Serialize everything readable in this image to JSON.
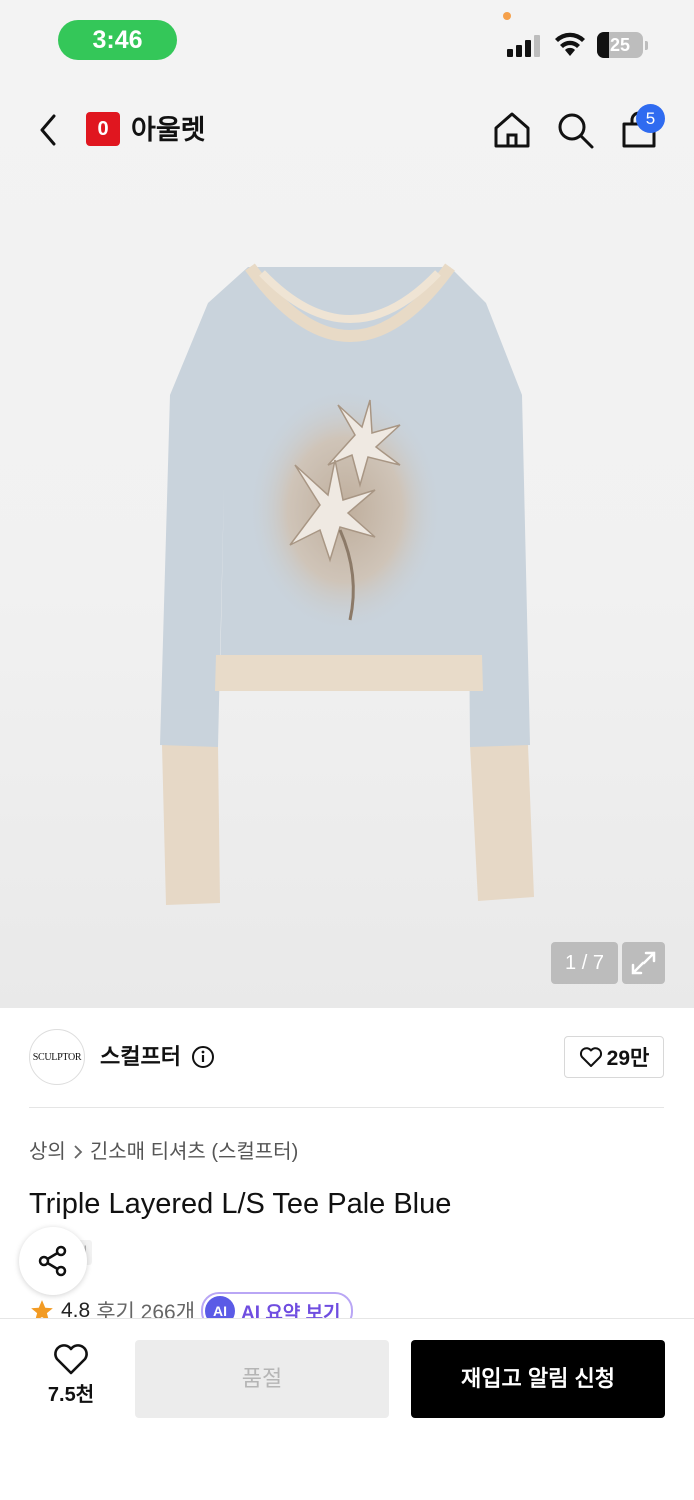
{
  "status_bar": {
    "time": "3:46",
    "battery": "25"
  },
  "header": {
    "brand_logo_letter": "0",
    "brand_name": "아울렛",
    "cart_count": "5"
  },
  "gallery": {
    "pager": "1 / 7"
  },
  "store": {
    "logo_text": "SCULPTOR",
    "name": "스컬프터",
    "likes": "29만"
  },
  "breadcrumb": [
    "상의",
    "긴소매 티셔츠 (스컬프터)"
  ],
  "product": {
    "title": "Triple Layered L/S Tee Pale Blue",
    "hidden_tag": "전",
    "rating": "4.8",
    "reviews": "후기 266개",
    "ai_badge": "AI",
    "ai_summary": "AI 요약 보기"
  },
  "bottom_bar": {
    "wish_count": "7.5천",
    "soldout_label": "품절",
    "restock_label": "재입고 알림 신청"
  },
  "colors": {
    "accent_blue": "#2f6bf0",
    "brand_red": "#e0161f",
    "rating_star": "#f29b24",
    "ai_purple": "#6f4de0"
  }
}
